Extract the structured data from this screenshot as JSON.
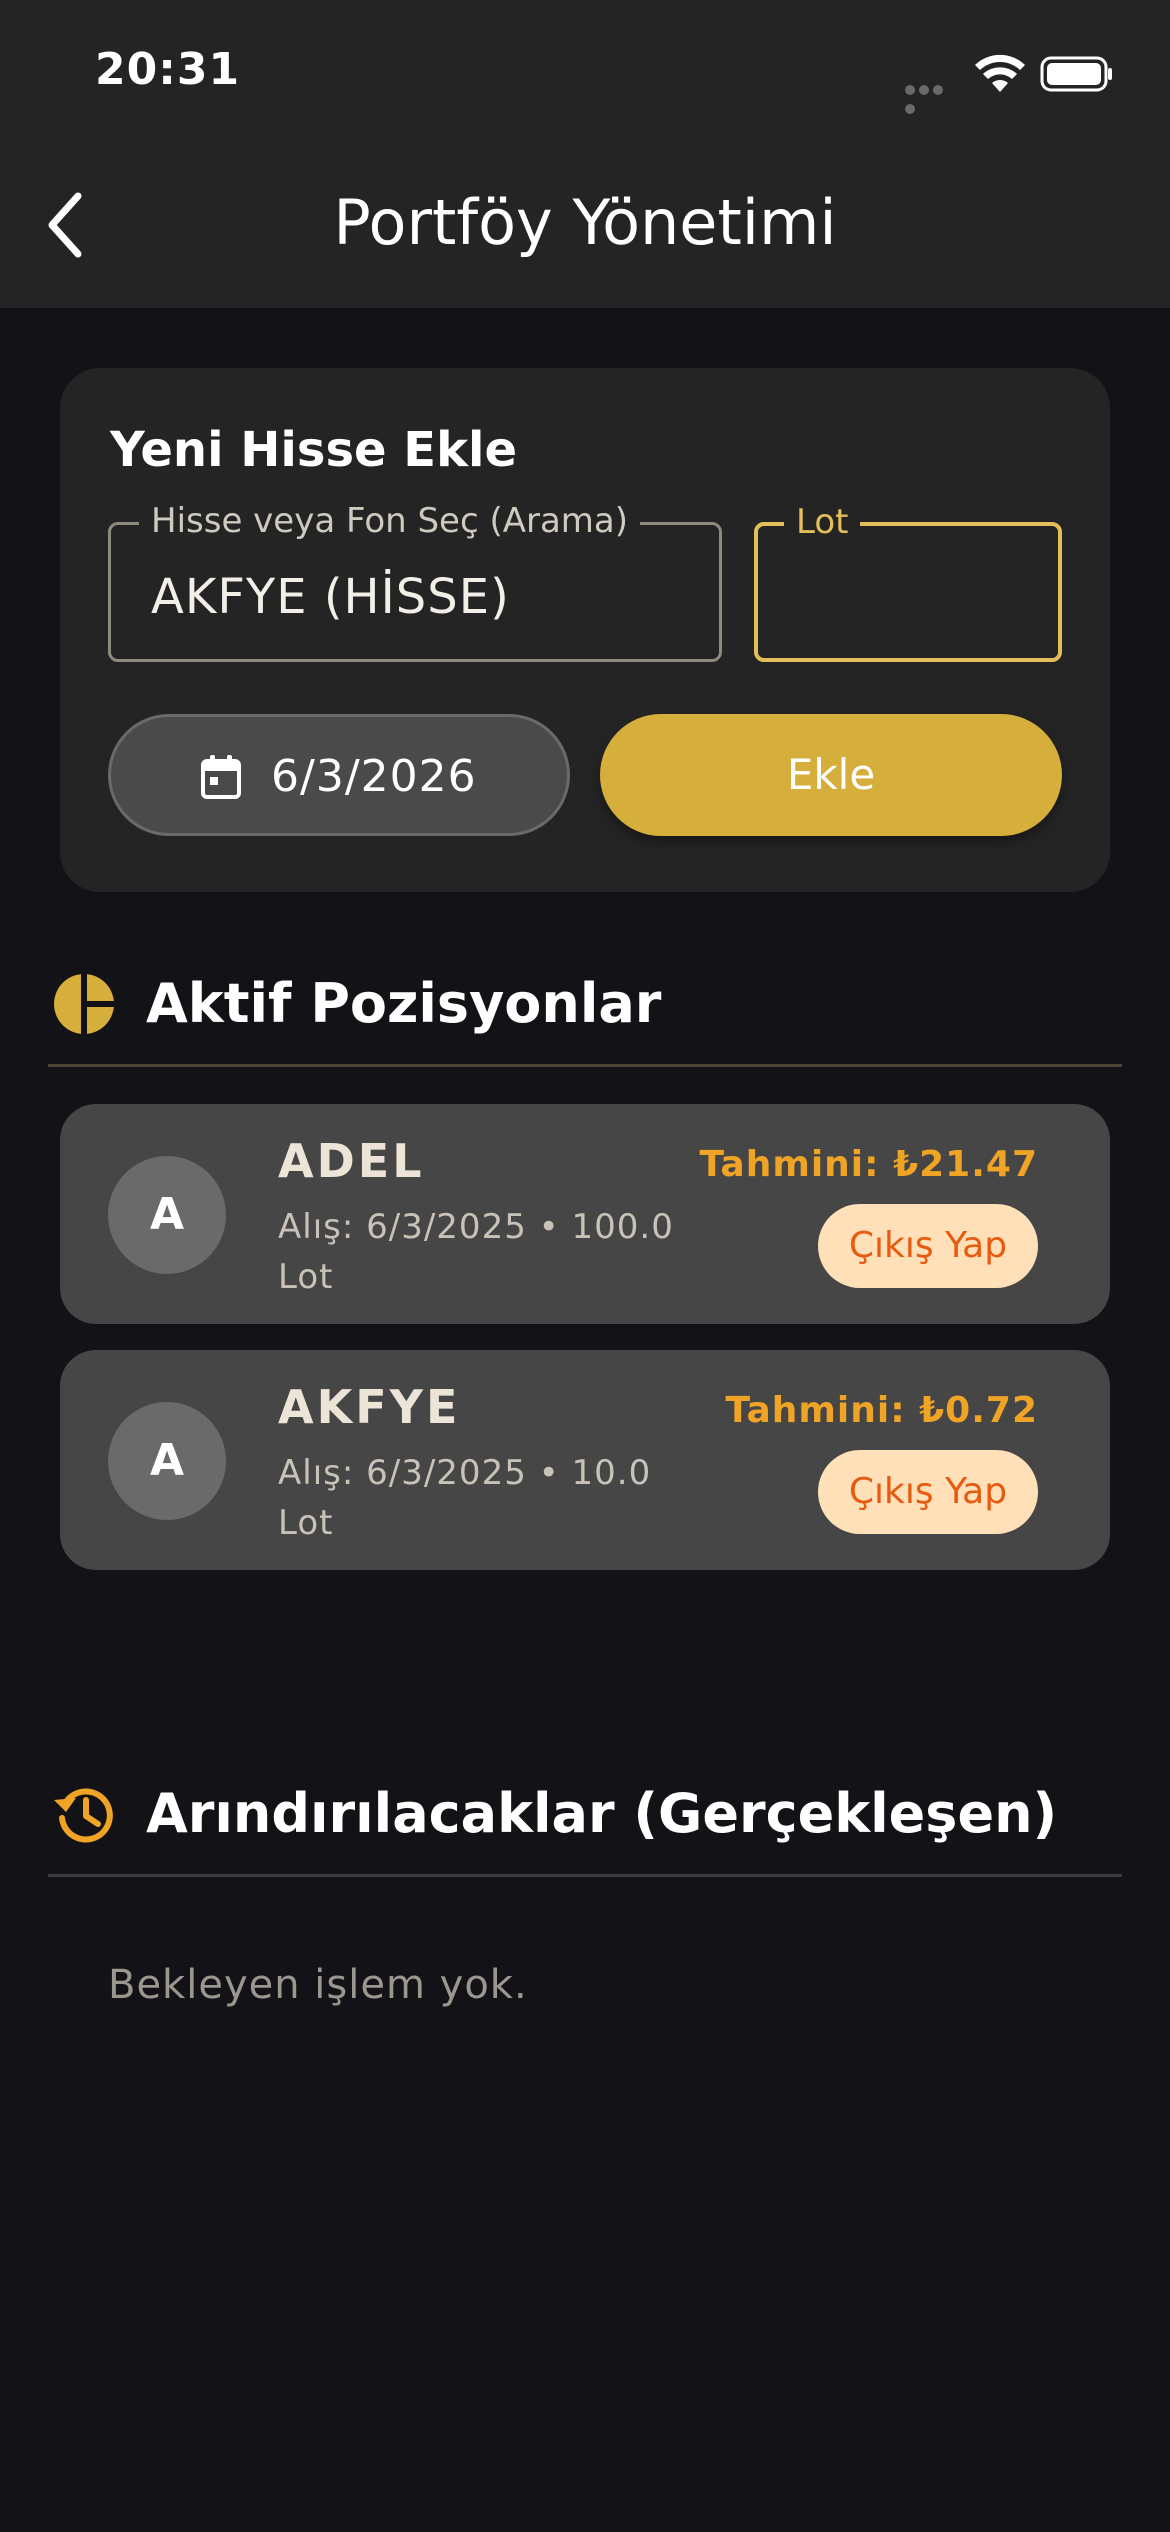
{
  "status_bar": {
    "time": "20:31"
  },
  "nav": {
    "title": "Portföy Yönetimi",
    "back_icon": "chevron-left-icon"
  },
  "add_form": {
    "title": "Yeni Hisse Ekle",
    "stock_label": "Hisse veya Fon Seç (Arama)",
    "stock_value": "AKFYE (HİSSE)",
    "lot_label": "Lot",
    "lot_value": "",
    "date_value": "6/3/2026",
    "add_label": "Ekle",
    "accent_color": "#d6ae3c"
  },
  "active_positions": {
    "title": "Aktif Pozisyonlar",
    "icon": "pie-chart-icon",
    "items": [
      {
        "avatar": "A",
        "symbol": "ADEL",
        "details": "Alış: 6/3/2025 • 100.0 Lot",
        "estimate": "Tahmini: ₺21.47",
        "exit_label": "Çıkış Yap"
      },
      {
        "avatar": "A",
        "symbol": "AKFYE",
        "details": "Alış: 6/3/2025 • 10.0 Lot",
        "estimate": "Tahmini: ₺0.72",
        "exit_label": "Çıkış Yap"
      }
    ]
  },
  "purification": {
    "title": "Arındırılacaklar (Gerçekleşen)",
    "icon": "history-icon",
    "empty_text": "Bekleyen işlem yok."
  },
  "colors": {
    "background": "#131217",
    "surface": "#242424",
    "card": "#464646",
    "gold": "#d6ae3c",
    "orange": "#f0a426",
    "exit_bg": "#ffe0b8",
    "exit_text": "#e85a10"
  }
}
